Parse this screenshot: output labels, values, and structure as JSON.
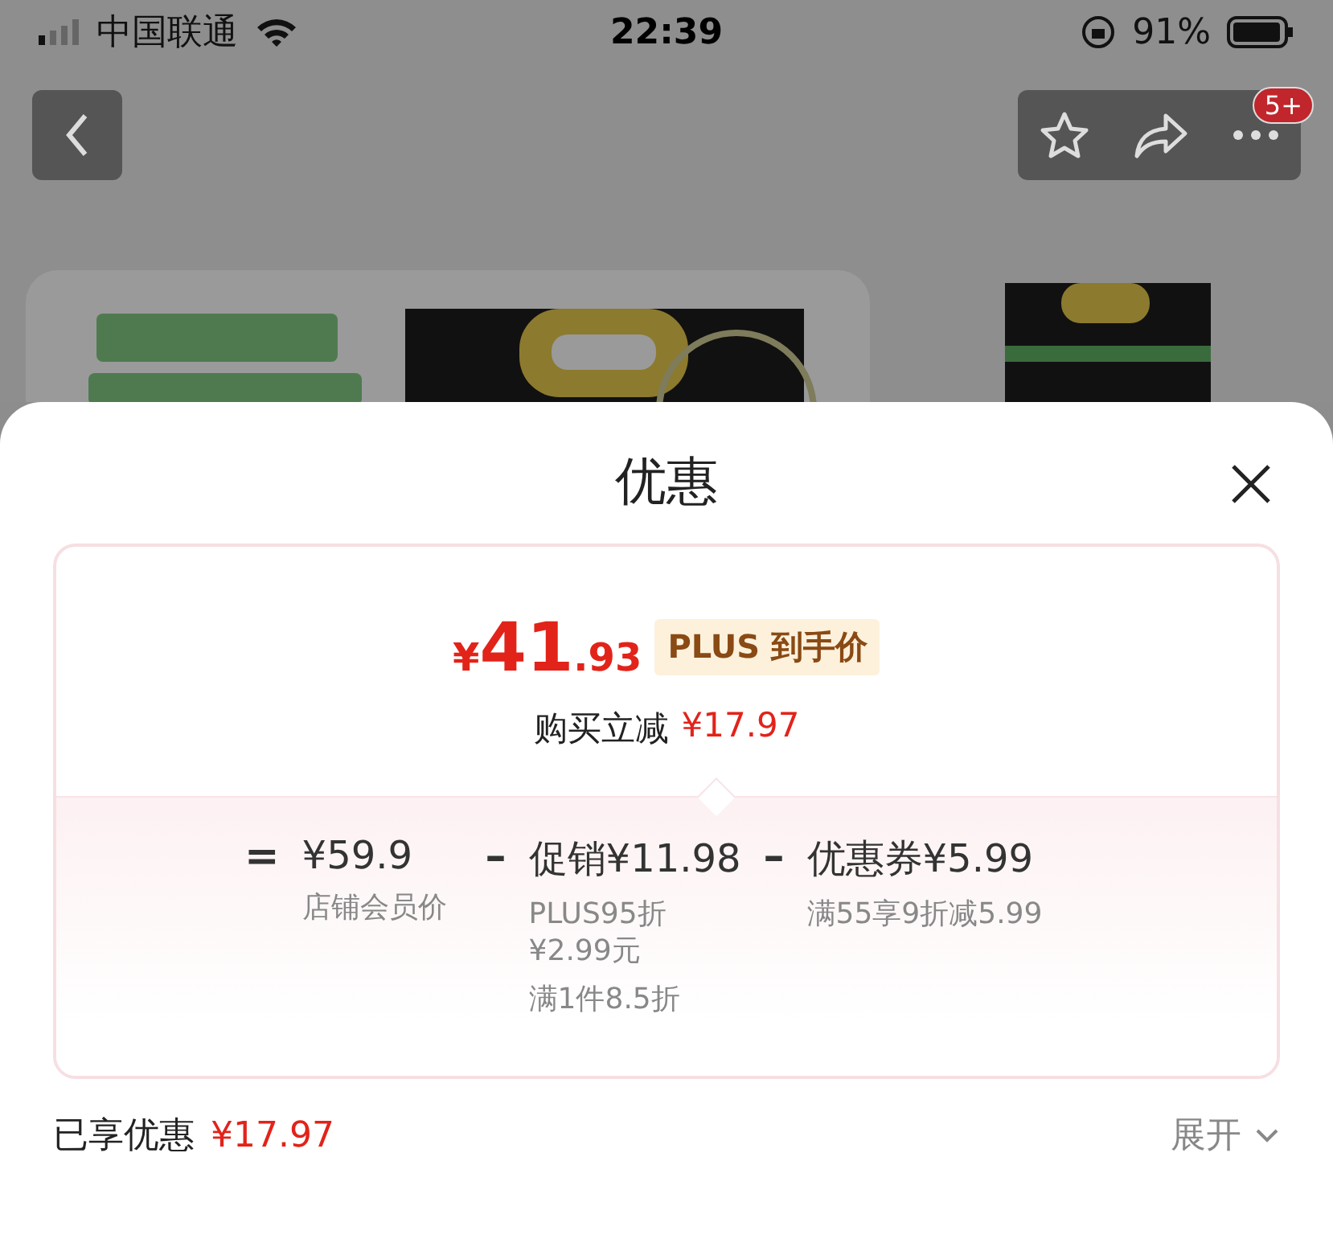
{
  "status_bar": {
    "carrier": "中国联通",
    "time": "22:39",
    "battery": "91%"
  },
  "nav": {
    "badge": "5+"
  },
  "sheet": {
    "title": "优惠",
    "price": {
      "currency": "¥",
      "integer": "41",
      "decimal": ".93",
      "tag": "PLUS 到手价",
      "reduction_label": "购买立减",
      "reduction_value": "¥17.97"
    },
    "breakdown": [
      {
        "operator": "=",
        "amount": "¥59.9",
        "notes": [
          "店铺会员价"
        ]
      },
      {
        "operator": "–",
        "name": "促销",
        "amount": "¥11.98",
        "notes": [
          "PLUS95折 ¥2.99元",
          "满1件8.5折"
        ]
      },
      {
        "operator": "–",
        "name": "优惠券",
        "amount": "¥5.99",
        "notes": [
          "满55享9折减5.99"
        ]
      }
    ],
    "summary": {
      "label": "已享优惠",
      "value": "¥17.97",
      "expand": "展开"
    }
  }
}
